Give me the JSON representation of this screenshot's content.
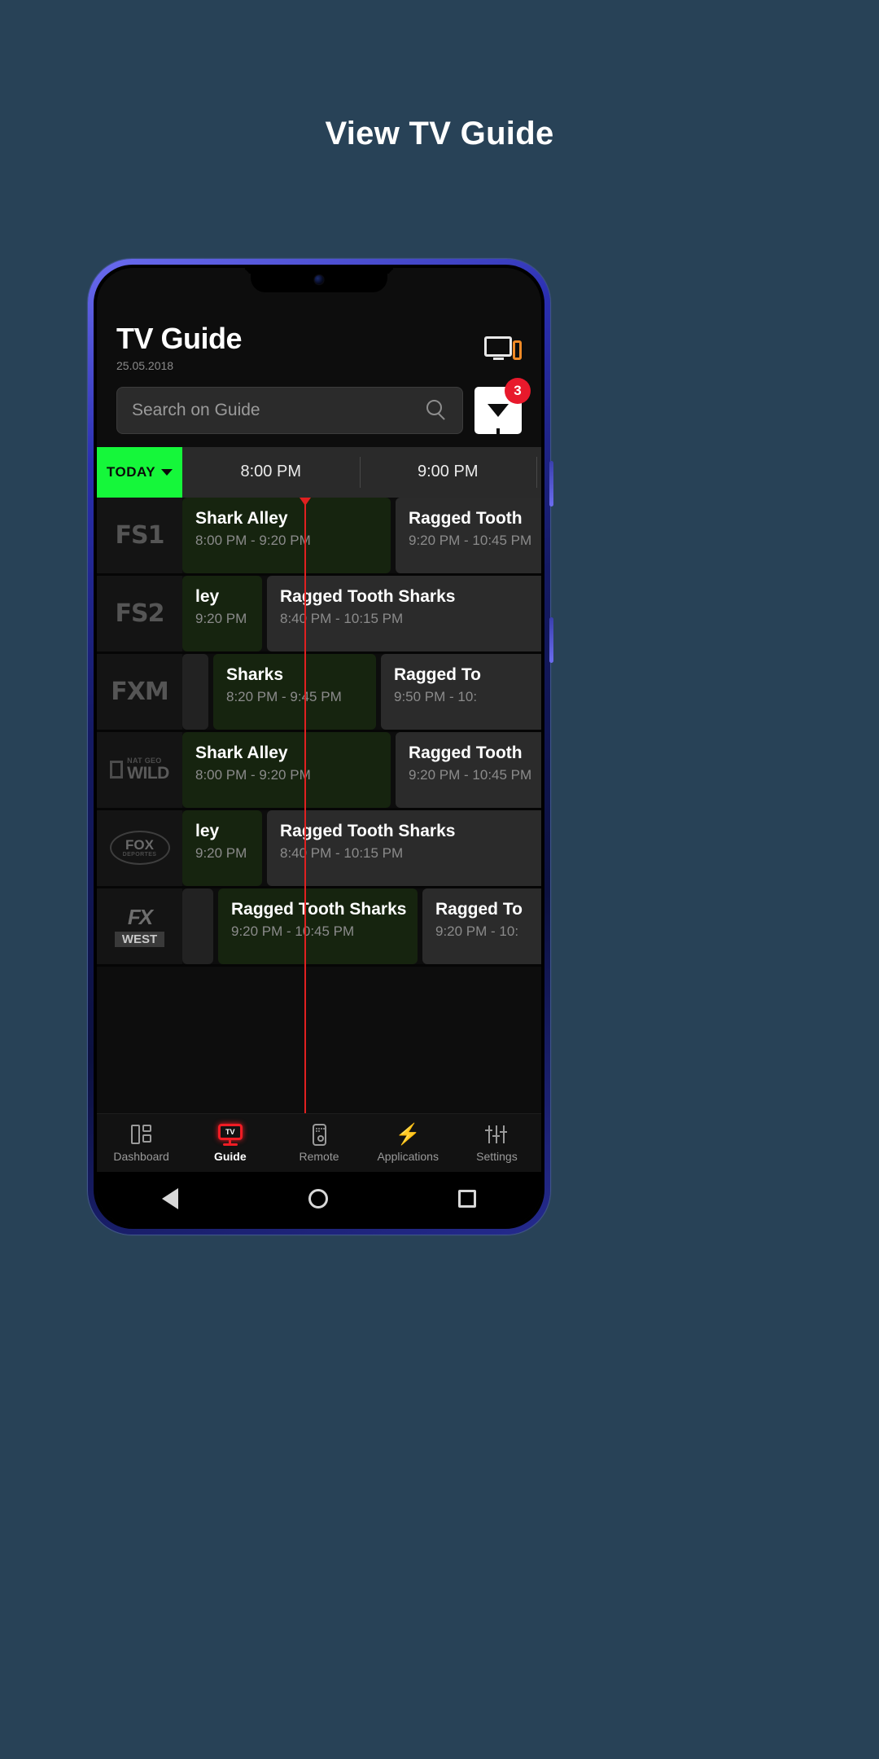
{
  "promo": {
    "headline": "View TV Guide"
  },
  "header": {
    "title": "TV Guide",
    "date": "25.05.2018",
    "cast_icon": "cast-screen-icon"
  },
  "search": {
    "placeholder": "Search on Guide",
    "value": "",
    "icon": "search-icon"
  },
  "filter": {
    "icon": "funnel-icon",
    "badge": "3"
  },
  "timeline": {
    "today_label": "TODAY",
    "slots": [
      "8:00 PM",
      "9:00 PM"
    ],
    "now_marker_color": "#e02020"
  },
  "colors": {
    "accent_green": "#15f73a",
    "badge_red": "#e8192c",
    "live_program": "#16240f",
    "upcoming_program": "#2b2b2b",
    "page_background": "#284257"
  },
  "guide": {
    "rows": [
      {
        "channel": "FS1",
        "logo_type": "text",
        "programs": [
          {
            "title": "Shark Alley",
            "time": "8:00 PM - 9:20 PM",
            "state": "live"
          },
          {
            "title": "Ragged Tooth",
            "time": "9:20 PM - 10:45 PM",
            "state": "next"
          }
        ]
      },
      {
        "channel": "FS2",
        "logo_type": "text",
        "programs": [
          {
            "title": "ley",
            "time": "9:20 PM",
            "state": "live"
          },
          {
            "title": "Ragged Tooth Sharks",
            "time": "8:40 PM - 10:15 PM",
            "state": "next"
          }
        ]
      },
      {
        "channel": "FXM",
        "logo_type": "text",
        "programs": [
          {
            "title": "",
            "time": "",
            "state": "past"
          },
          {
            "title": "Sharks",
            "time": "8:20 PM - 9:45 PM",
            "state": "live"
          },
          {
            "title": "Ragged To",
            "time": "9:50 PM - 10:",
            "state": "next"
          }
        ]
      },
      {
        "channel": "NAT GEO WILD",
        "logo_type": "natgeo",
        "logo_small": "NAT GEO",
        "logo_big": "WILD",
        "programs": [
          {
            "title": "Shark Alley",
            "time": "8:00 PM - 9:20 PM",
            "state": "live"
          },
          {
            "title": "Ragged Tooth",
            "time": "9:20 PM - 10:45 PM",
            "state": "next"
          }
        ]
      },
      {
        "channel": "FOX DEPORTES",
        "logo_type": "foxoval",
        "logo_t1": "FOX",
        "logo_t2": "DEPORTES",
        "programs": [
          {
            "title": "ley",
            "time": "9:20 PM",
            "state": "live"
          },
          {
            "title": "Ragged Tooth Sharks",
            "time": "8:40 PM - 10:15 PM",
            "state": "next"
          }
        ]
      },
      {
        "channel": "FX WEST",
        "logo_type": "fxwest",
        "logo_fx": "FX",
        "logo_west": "WEST",
        "programs": [
          {
            "title": "",
            "time": "",
            "state": "past"
          },
          {
            "title": "Ragged Tooth Sharks",
            "time": "9:20 PM - 10:45 PM",
            "state": "live"
          },
          {
            "title": "Ragged To",
            "time": "9:20 PM - 10:",
            "state": "next"
          }
        ]
      }
    ]
  },
  "bottom_nav": {
    "items": [
      {
        "label": "Dashboard",
        "icon": "dashboard-icon",
        "active": false
      },
      {
        "label": "Guide",
        "icon": "tv-icon",
        "active": true
      },
      {
        "label": "Remote",
        "icon": "remote-icon",
        "active": false
      },
      {
        "label": "Applications",
        "icon": "bolt-icon",
        "active": false
      },
      {
        "label": "Settings",
        "icon": "sliders-icon",
        "active": false
      }
    ]
  },
  "system_nav": {
    "back": "back-triangle-icon",
    "home": "home-circle-icon",
    "recents": "recents-square-icon"
  }
}
